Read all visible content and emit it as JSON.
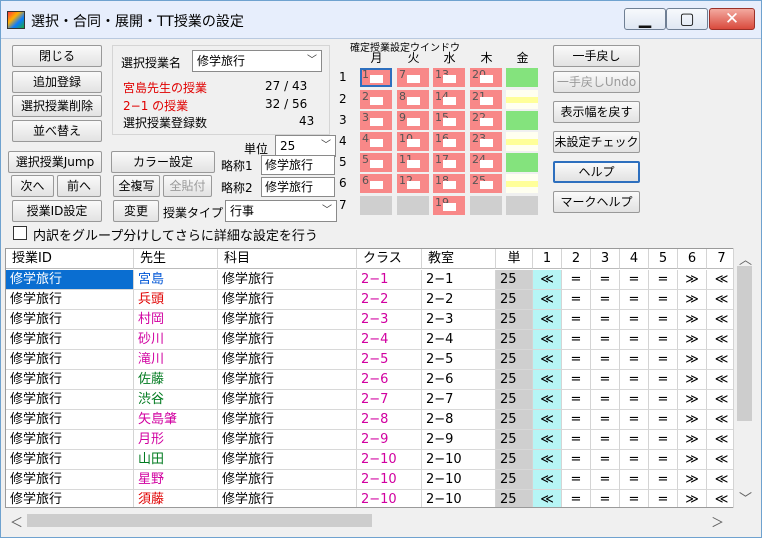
{
  "window": {
    "title": "選択・合同・展開・TT授業の設定"
  },
  "left_buttons": {
    "close": "閉じる",
    "add": "追加登録",
    "delete": "選択授業削除",
    "sort": "並べ替え",
    "jump": "選択授業Jump",
    "next": "次へ",
    "prev": "前へ",
    "idset": "授業ID設定"
  },
  "info": {
    "selected_label": "選択授業名",
    "selected_value": "修学旅行",
    "teacher_line": "宮島先生の授業",
    "teacher_count": "27 / 43",
    "class_line": "2−1 の授業",
    "class_count": "32 / 56",
    "reg_label": "選択授業登録数",
    "reg_count": "43"
  },
  "mid": {
    "color_btn": "カラー設定",
    "copy_all": "全複写",
    "paste_all": "全貼付",
    "change": "変更",
    "unit_label": "単位",
    "unit_value": "25",
    "abbr1_label": "略称1",
    "abbr1_value": "修学旅行",
    "abbr2_label": "略称2",
    "abbr2_value": "修学旅行",
    "type_label": "授業タイプ",
    "type_value": "行事"
  },
  "grid": {
    "title": "確定授業設定ウインドウ",
    "days": [
      "月",
      "火",
      "水",
      "木",
      "金"
    ],
    "periods": [
      "1",
      "2",
      "3",
      "4",
      "5",
      "6",
      "7"
    ],
    "slot_numbers": {
      "mon": [
        "1",
        "2",
        "3",
        "4",
        "5",
        "6",
        ""
      ],
      "tue": [
        "7",
        "8",
        "9",
        "10",
        "11",
        "12",
        ""
      ],
      "wed": [
        "13",
        "14",
        "15",
        "16",
        "17",
        "18",
        "19"
      ],
      "thu": [
        "20",
        "21",
        "22",
        "23",
        "24",
        "25",
        ""
      ]
    }
  },
  "right_buttons": {
    "undo": "一手戻し",
    "undo_redo": "一手戻しUndo",
    "reset_width": "表示幅を戻す",
    "check": "未設定チェック",
    "help": "ヘルプ",
    "mark_help": "マークヘルプ"
  },
  "checkbox": {
    "label": "内訳をグループ分けしてさらに詳細な設定を行う"
  },
  "table": {
    "headers": [
      "授業ID",
      "先生",
      "科目",
      "クラス",
      "教室",
      "単",
      "1",
      "2",
      "3",
      "4",
      "5",
      "6",
      "7"
    ],
    "rows": [
      {
        "id": "修学旅行",
        "teacher": "宮島",
        "tcolor": "blue",
        "subject": "修学旅行",
        "cls": "2−1",
        "room": "2−1",
        "unit": "25",
        "p": [
          "≪",
          "=",
          "=",
          "=",
          "=",
          "≫",
          "≪"
        ]
      },
      {
        "id": "修学旅行",
        "teacher": "兵頭",
        "tcolor": "red",
        "subject": "修学旅行",
        "cls": "2−2",
        "room": "2−2",
        "unit": "25",
        "p": [
          "≪",
          "=",
          "=",
          "=",
          "=",
          "≫",
          "≪"
        ]
      },
      {
        "id": "修学旅行",
        "teacher": "村岡",
        "tcolor": "pink",
        "subject": "修学旅行",
        "cls": "2−3",
        "room": "2−3",
        "unit": "25",
        "p": [
          "≪",
          "=",
          "=",
          "=",
          "=",
          "≫",
          "≪"
        ]
      },
      {
        "id": "修学旅行",
        "teacher": "砂川",
        "tcolor": "pink",
        "subject": "修学旅行",
        "cls": "2−4",
        "room": "2−4",
        "unit": "25",
        "p": [
          "≪",
          "=",
          "=",
          "=",
          "=",
          "≫",
          "≪"
        ]
      },
      {
        "id": "修学旅行",
        "teacher": "滝川",
        "tcolor": "pink",
        "subject": "修学旅行",
        "cls": "2−5",
        "room": "2−5",
        "unit": "25",
        "p": [
          "≪",
          "=",
          "=",
          "=",
          "=",
          "≫",
          "≪"
        ]
      },
      {
        "id": "修学旅行",
        "teacher": "佐藤",
        "tcolor": "green",
        "subject": "修学旅行",
        "cls": "2−6",
        "room": "2−6",
        "unit": "25",
        "p": [
          "≪",
          "=",
          "=",
          "=",
          "=",
          "≫",
          "≪"
        ]
      },
      {
        "id": "修学旅行",
        "teacher": "渋谷",
        "tcolor": "green",
        "subject": "修学旅行",
        "cls": "2−7",
        "room": "2−7",
        "unit": "25",
        "p": [
          "≪",
          "=",
          "=",
          "=",
          "=",
          "≫",
          "≪"
        ]
      },
      {
        "id": "修学旅行",
        "teacher": "矢島肇",
        "tcolor": "pink",
        "subject": "修学旅行",
        "cls": "2−8",
        "room": "2−8",
        "unit": "25",
        "p": [
          "≪",
          "=",
          "=",
          "=",
          "=",
          "≫",
          "≪"
        ]
      },
      {
        "id": "修学旅行",
        "teacher": "月形",
        "tcolor": "pink",
        "subject": "修学旅行",
        "cls": "2−9",
        "room": "2−9",
        "unit": "25",
        "p": [
          "≪",
          "=",
          "=",
          "=",
          "=",
          "≫",
          "≪"
        ]
      },
      {
        "id": "修学旅行",
        "teacher": "山田",
        "tcolor": "green",
        "subject": "修学旅行",
        "cls": "2−10",
        "room": "2−10",
        "unit": "25",
        "p": [
          "≪",
          "=",
          "=",
          "=",
          "=",
          "≫",
          "≪"
        ]
      },
      {
        "id": "修学旅行",
        "teacher": "星野",
        "tcolor": "pink",
        "subject": "修学旅行",
        "cls": "2−10",
        "room": "2−10",
        "unit": "25",
        "p": [
          "≪",
          "=",
          "=",
          "=",
          "=",
          "≫",
          "≪"
        ]
      },
      {
        "id": "修学旅行",
        "teacher": "須藤",
        "tcolor": "red",
        "subject": "修学旅行",
        "cls": "2−10",
        "room": "2−10",
        "unit": "25",
        "p": [
          "≪",
          "=",
          "=",
          "=",
          "=",
          "≫",
          "≪"
        ]
      }
    ]
  }
}
